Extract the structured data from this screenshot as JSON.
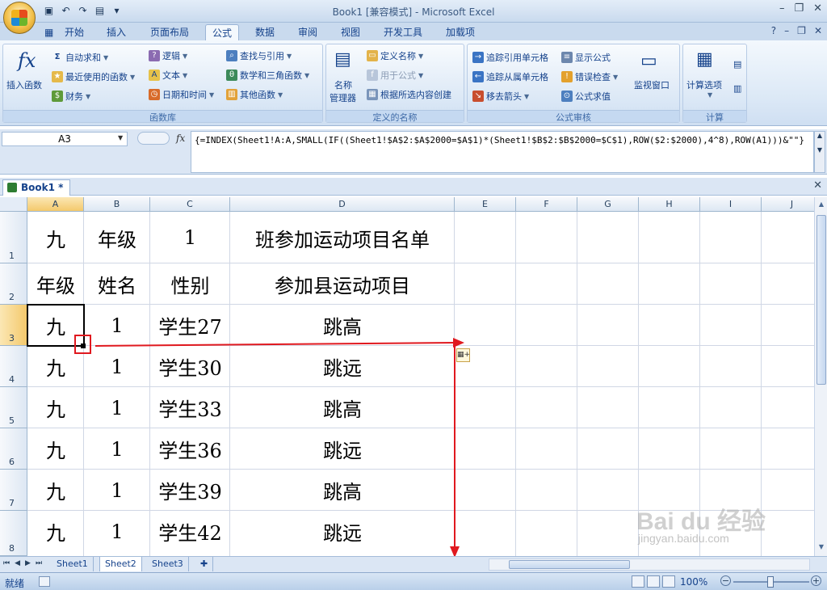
{
  "window": {
    "title": "Book1  [兼容模式] - Microsoft Excel"
  },
  "tabs": [
    "开始",
    "插入",
    "页面布局",
    "公式",
    "数据",
    "审阅",
    "视图",
    "开发工具",
    "加载项"
  ],
  "active_tab": "公式",
  "ribbon": {
    "function_library": {
      "label": "函数库",
      "insert_function": "插入函数",
      "autosum": "自动求和",
      "recent": "最近使用的函数",
      "financial": "财务",
      "logical": "逻辑",
      "text": "文本",
      "datetime": "日期和时间",
      "lookup": "查找与引用",
      "math": "数学和三角函数",
      "more": "其他函数"
    },
    "defined_names": {
      "label": "定义的名称",
      "name_manager_1": "名称",
      "name_manager_2": "管理器",
      "define_name": "定义名称",
      "use_in_formula": "用于公式",
      "create_from_selection": "根据所选内容创建"
    },
    "formula_auditing": {
      "label": "公式审核",
      "trace_precedents": "追踪引用单元格",
      "trace_dependents": "追踪从属单元格",
      "remove_arrows": "移去箭头",
      "show_formulas": "显示公式",
      "error_checking": "错误检查",
      "evaluate_formula": "公式求值",
      "watch_window": "监视窗口"
    },
    "calculation": {
      "label": "计算",
      "options": "计算选项"
    }
  },
  "formula_bar": {
    "name_box": "A3",
    "formula": "{=INDEX(Sheet1!A:A,SMALL(IF((Sheet1!$A$2:$A$2000=$A$1)*(Sheet1!$B$2:$B$2000=$C$1),ROW($2:$2000),4^8),ROW(A1)))&\"\"}"
  },
  "workbook_tab": "Book1 *",
  "columns": [
    "A",
    "B",
    "C",
    "D",
    "E",
    "F",
    "G",
    "H",
    "I",
    "J"
  ],
  "rows": [
    "1",
    "2",
    "3",
    "4",
    "5",
    "6",
    "7",
    "8"
  ],
  "cells": {
    "r1": {
      "a": "九",
      "b": "年级",
      "c": "1",
      "d": "班参加运动项目名单"
    },
    "r2": {
      "a": "年级",
      "b": "姓名",
      "c": "性别",
      "d": "参加县运动项目"
    },
    "r3": {
      "a": "九",
      "b": "1",
      "c": "学生27",
      "d": "跳高"
    },
    "r4": {
      "a": "九",
      "b": "1",
      "c": "学生30",
      "d": "跳远"
    },
    "r5": {
      "a": "九",
      "b": "1",
      "c": "学生33",
      "d": "跳高"
    },
    "r6": {
      "a": "九",
      "b": "1",
      "c": "学生36",
      "d": "跳远"
    },
    "r7": {
      "a": "九",
      "b": "1",
      "c": "学生39",
      "d": "跳高"
    },
    "r8": {
      "a": "九",
      "b": "1",
      "c": "学生42",
      "d": "跳远"
    }
  },
  "sheet_tabs": [
    "Sheet1",
    "Sheet2",
    "Sheet3"
  ],
  "active_sheet": "Sheet2",
  "status": {
    "ready": "就绪",
    "zoom": "100%"
  },
  "watermark": {
    "brand": "Bai du 经验",
    "url": "jingyan.baidu.com"
  },
  "accent_colors": {
    "arrow": "#e0191f",
    "selected_header": "#f4c96c"
  }
}
